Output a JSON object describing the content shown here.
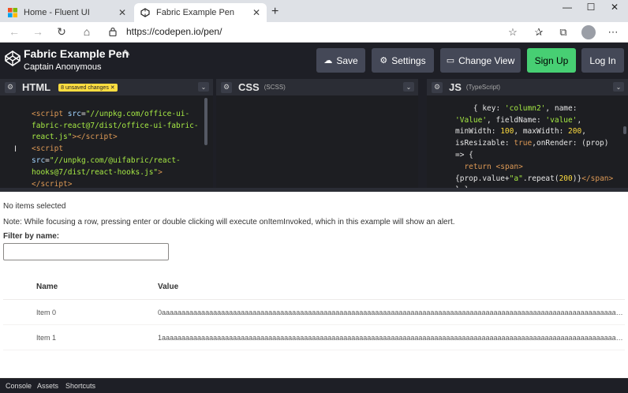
{
  "browser": {
    "tabs": [
      {
        "title": "Home - Fluent UI",
        "close": "✕"
      },
      {
        "title": "Fabric Example Pen",
        "close": "✕"
      }
    ],
    "new_tab": "+",
    "window_controls": [
      "—",
      "☐",
      "✕"
    ],
    "url": "https://codepen.io/pen/",
    "nav": {
      "back": "←",
      "forward": "→",
      "reload": "↻",
      "home": "⌂"
    },
    "toolbar_icons": {
      "favorite": "☆",
      "favorites": "✰",
      "collections": "⧉",
      "menu": "⋯"
    }
  },
  "codepen": {
    "pen_title": "Fabric Example Pen",
    "edit_icon": "✎",
    "author": "Captain Anonymous",
    "buttons": {
      "save": "Save",
      "settings": "Settings",
      "change_view": "Change View",
      "signup": "Sign Up",
      "login": "Log In"
    },
    "button_icons": {
      "save": "☁",
      "settings": "⚙",
      "change_view": "▭"
    },
    "colors": {
      "header_bg": "#1e1f26",
      "signup": "#47cf73",
      "button": "#444857",
      "unsaved": "#ffdd40"
    }
  },
  "editors": {
    "html": {
      "title": "HTML",
      "badge": "8 unsaved changes ✕",
      "gear": "⚙",
      "toggle": "⌄"
    },
    "css": {
      "title": "CSS",
      "sub": "(SCSS)",
      "gear": "⚙",
      "toggle": "⌄"
    },
    "js": {
      "title": "JS",
      "sub": "(TypeScript)",
      "gear": "⚙",
      "toggle": "⌄"
    }
  },
  "result": {
    "selection_status": "No items selected",
    "note": "Note: While focusing a row, pressing enter or double clicking will execute onItemInvoked, which in this example will show an alert.",
    "filter_label": "Filter by name:",
    "filter_value": "",
    "columns": [
      "Name",
      "Value"
    ],
    "rows": [
      {
        "name": "Item 0",
        "value": "0aaaaaaaaaaaaaaaaaaaaaaaaaaaaaaaaaaaaaaaaaaaaaaaaaaaaaaaaaaaaaaaaaaaaaaaaaaaaaaaaaaaaaaaaaaaaaaaaaaaaaaaaaaaaaaaaaaaaaaaaaaaaaaaaaaaaa..."
      },
      {
        "name": "Item 1",
        "value": "1aaaaaaaaaaaaaaaaaaaaaaaaaaaaaaaaaaaaaaaaaaaaaaaaaaaaaaaaaaaaaaaaaaaaaaaaaaaaaaaaaaaaaaaaaaaaaaaaaaaaaaaaaaaaaaaaaaaaaaaaaaaaaaaaaaaaa..."
      }
    ]
  },
  "bottom_bar": [
    "Console",
    "Assets",
    "Shortcuts"
  ]
}
